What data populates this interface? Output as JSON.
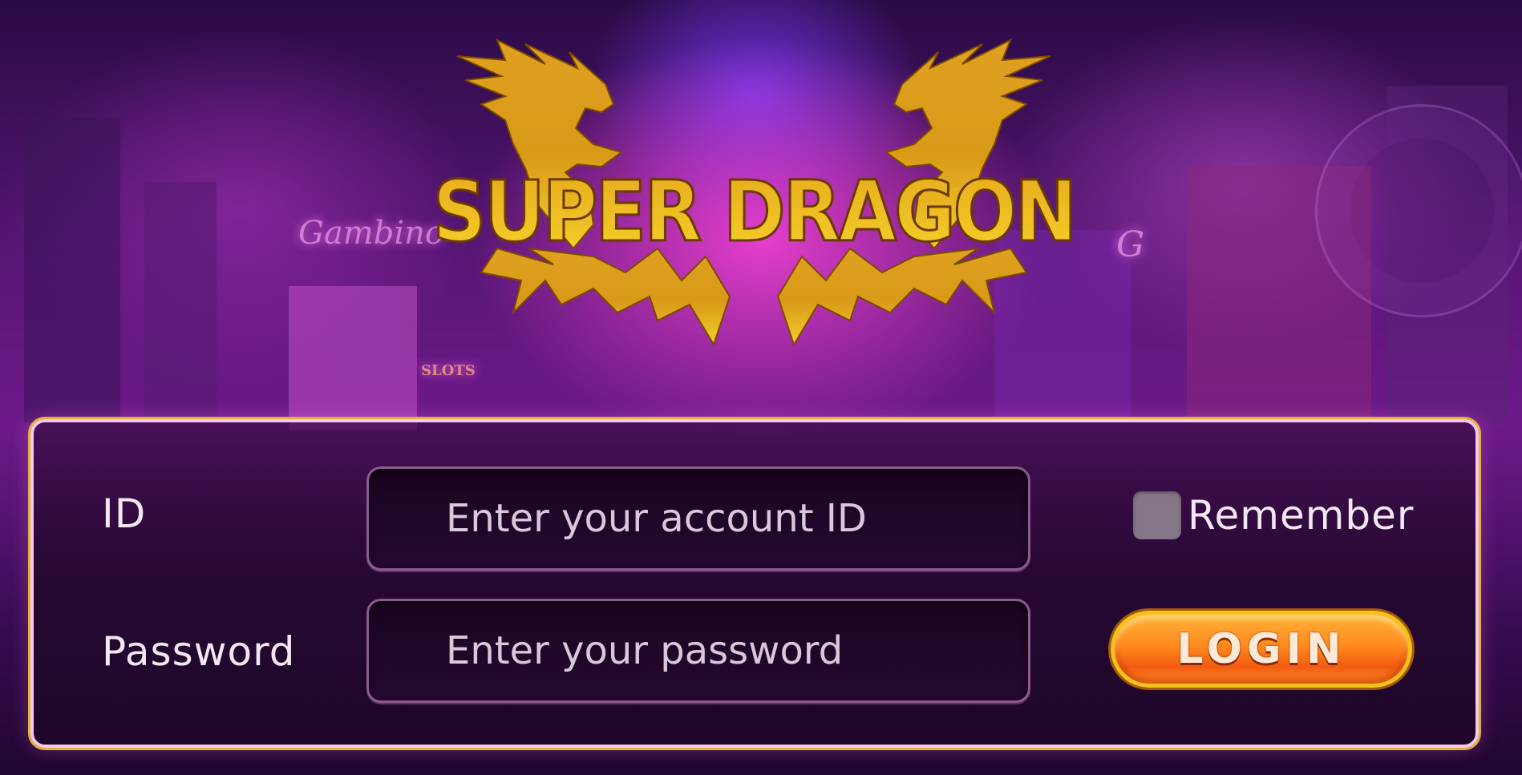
{
  "logo": {
    "title": "SUPER DRAGON"
  },
  "background_signs": {
    "left_sign": "Gambino",
    "right_sign": "G",
    "slots_sign": "SLOTS"
  },
  "login_form": {
    "id_label": "ID",
    "id_placeholder": "Enter your account ID",
    "password_label": "Password",
    "password_placeholder": "Enter your password",
    "remember_label": "Remember",
    "remember_checked": false,
    "login_button_label": "LOGIN"
  },
  "colors": {
    "logo_gold": "#d9a21e",
    "panel_border": "#f7c8ee",
    "panel_outline": "#e3b23a",
    "button_orange": "#f25c12",
    "button_border": "#f5c11d",
    "checkbox_gray": "#867788"
  }
}
